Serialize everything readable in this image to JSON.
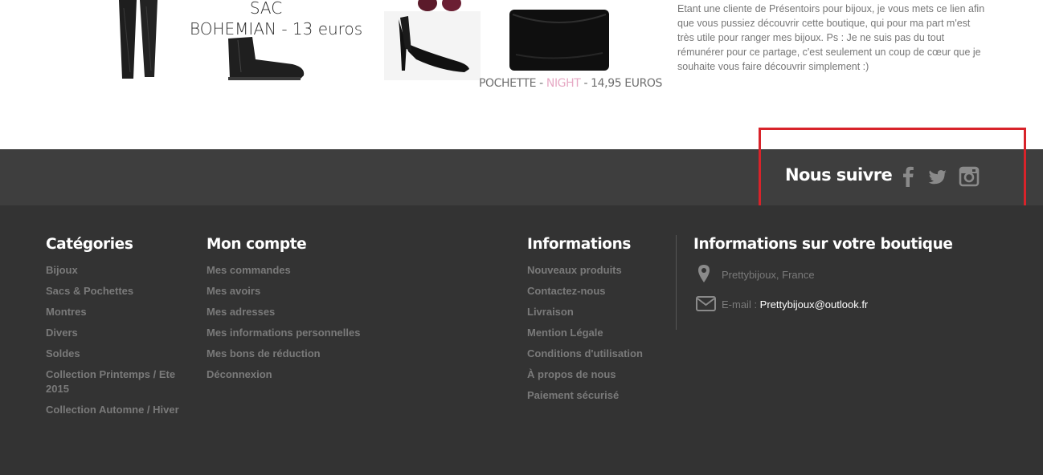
{
  "product": {
    "sac_line1": "SAC",
    "sac_line2": "BOHEMIAN - 13 euros",
    "pochette_prefix": "POCHETTE - ",
    "pochette_night": "NIGHT",
    "pochette_suffix": " - 14,95 EUROS",
    "blurb": "Etant une cliente de Présentoirs pour bijoux, je vous mets ce lien afin que vous pussiez découvrir cette boutique, qui pour ma part m'est très utile pour ranger mes bijoux. Ps : Je ne suis pas du tout rémunérer pour ce partage, c'est seulement un coup de cœur que je souhaite vous faire découvrir simplement :)"
  },
  "follow": {
    "title": "Nous suivre",
    "icons": [
      "facebook-icon",
      "twitter-icon",
      "instagram-icon"
    ]
  },
  "footer": {
    "categories": {
      "title": "Catégories",
      "items": [
        "Bijoux",
        "Sacs & Pochettes",
        "Montres",
        "Divers",
        "Soldes",
        "Collection Printemps / Ete 2015",
        "Collection Automne / Hiver"
      ]
    },
    "account": {
      "title": "Mon compte",
      "items": [
        "Mes commandes",
        "Mes avoirs",
        "Mes adresses",
        "Mes informations personnelles",
        "Mes bons de réduction",
        "Déconnexion"
      ]
    },
    "informations": {
      "title": "Informations",
      "items": [
        "Nouveaux produits",
        "Contactez-nous",
        "Livraison",
        "Mention Légale",
        "Conditions d'utilisation",
        "À propos de nous",
        "Paiement sécurisé"
      ]
    },
    "store": {
      "title": "Informations sur votre boutique",
      "location": "Prettybijoux, France",
      "email_label": "E-mail : ",
      "email_value": "Prettybijoux@outlook.fr"
    }
  },
  "colors": {
    "footer_bg": "#333333",
    "follow_bg": "#3e3e3e",
    "highlight": "#d8232a",
    "accent_pink": "#e6a9c4"
  }
}
